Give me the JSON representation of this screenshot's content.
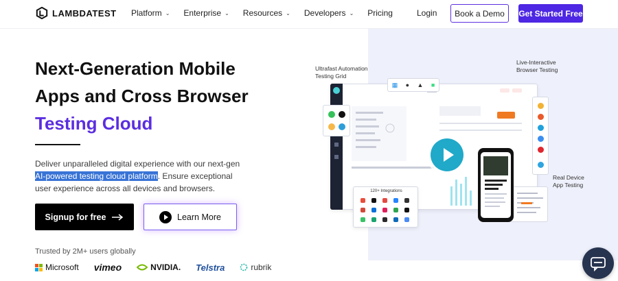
{
  "brand": {
    "name": "LAMBDATEST"
  },
  "nav": {
    "items": [
      {
        "label": "Platform",
        "has_dropdown": true
      },
      {
        "label": "Enterprise",
        "has_dropdown": true
      },
      {
        "label": "Resources",
        "has_dropdown": true
      },
      {
        "label": "Developers",
        "has_dropdown": true
      },
      {
        "label": "Pricing",
        "has_dropdown": false
      }
    ],
    "login_label": "Login",
    "demo_label": "Book a Demo",
    "get_started_label": "Get Started Free"
  },
  "hero": {
    "headline_line1": "Next-Generation Mobile",
    "headline_line2": "Apps and Cross Browser",
    "headline_line3": "Testing Cloud",
    "desc_part1": "Deliver unparalleled digital experience with our next-gen ",
    "desc_highlight": "AI-powered testing cloud platform",
    "desc_part2": ". Ensure exceptional user experience across all devices and browsers.",
    "signup_label": "Signup for free",
    "learn_label": "Learn More",
    "trusted_text": "Trusted by 2M+ users globally"
  },
  "logos": [
    "Microsoft",
    "vimeo",
    "NVIDIA.",
    "Telstra",
    "rubrik"
  ],
  "illustration": {
    "callout_grid": "Ultrafast Automation\nTesting Grid",
    "callout_live": "Live-Interactive\nBrowser Testing",
    "callout_device": "Real Device\nApp Testing",
    "integrations_title": "120+ Integrations"
  },
  "colors": {
    "accent": "#5b2ee0",
    "cta_primary": "#4d27e3",
    "highlight": "#3873d6",
    "panel_bg": "#eef0fb",
    "chat_bg": "#27344f"
  },
  "icons": [
    "logo-icon",
    "chevron-down-icon",
    "arrow-right-icon",
    "play-icon",
    "chat-icon"
  ]
}
